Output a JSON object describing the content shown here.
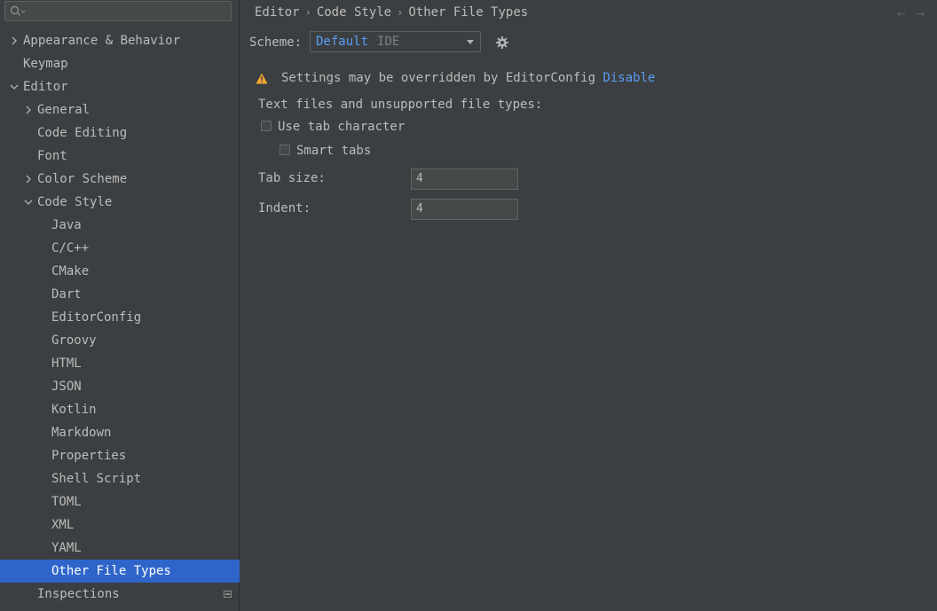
{
  "search": {
    "placeholder": ""
  },
  "tree": [
    {
      "label": "Appearance & Behavior",
      "level": 0,
      "chevron": "right"
    },
    {
      "label": "Keymap",
      "level": 0,
      "chevron": "none"
    },
    {
      "label": "Editor",
      "level": 0,
      "chevron": "down"
    },
    {
      "label": "General",
      "level": 1,
      "chevron": "right"
    },
    {
      "label": "Code Editing",
      "level": 1,
      "chevron": "none"
    },
    {
      "label": "Font",
      "level": 1,
      "chevron": "none"
    },
    {
      "label": "Color Scheme",
      "level": 1,
      "chevron": "right"
    },
    {
      "label": "Code Style",
      "level": 1,
      "chevron": "down"
    },
    {
      "label": "Java",
      "level": 2,
      "chevron": "none"
    },
    {
      "label": "C/C++",
      "level": 2,
      "chevron": "none"
    },
    {
      "label": "CMake",
      "level": 2,
      "chevron": "none"
    },
    {
      "label": "Dart",
      "level": 2,
      "chevron": "none"
    },
    {
      "label": "EditorConfig",
      "level": 2,
      "chevron": "none"
    },
    {
      "label": "Groovy",
      "level": 2,
      "chevron": "none"
    },
    {
      "label": "HTML",
      "level": 2,
      "chevron": "none"
    },
    {
      "label": "JSON",
      "level": 2,
      "chevron": "none"
    },
    {
      "label": "Kotlin",
      "level": 2,
      "chevron": "none"
    },
    {
      "label": "Markdown",
      "level": 2,
      "chevron": "none"
    },
    {
      "label": "Properties",
      "level": 2,
      "chevron": "none"
    },
    {
      "label": "Shell Script",
      "level": 2,
      "chevron": "none"
    },
    {
      "label": "TOML",
      "level": 2,
      "chevron": "none"
    },
    {
      "label": "XML",
      "level": 2,
      "chevron": "none"
    },
    {
      "label": "YAML",
      "level": 2,
      "chevron": "none"
    },
    {
      "label": "Other File Types",
      "level": 2,
      "chevron": "none",
      "selected": true
    },
    {
      "label": "Inspections",
      "level": 1,
      "chevron": "none",
      "badge": true
    }
  ],
  "breadcrumb": {
    "items": [
      "Editor",
      "Code Style",
      "Other File Types"
    ],
    "separator": "›"
  },
  "nav": {
    "back": "←",
    "forward": "→"
  },
  "scheme": {
    "label": "Scheme:",
    "name": "Default",
    "kind": "IDE"
  },
  "warning": {
    "text": "Settings may be overridden by EditorConfig",
    "link": "Disable"
  },
  "section": {
    "title": "Text files and unsupported file types:"
  },
  "options": {
    "use_tab": "Use tab character",
    "smart_tabs": "Smart tabs"
  },
  "fields": {
    "tab_size": {
      "label": "Tab size:",
      "value": "4"
    },
    "indent": {
      "label": "Indent:",
      "value": "4"
    }
  },
  "colors": {
    "accent": "#589df6",
    "selection": "#2f65ca",
    "background": "#3c3f41",
    "warning": "#f0a732"
  }
}
